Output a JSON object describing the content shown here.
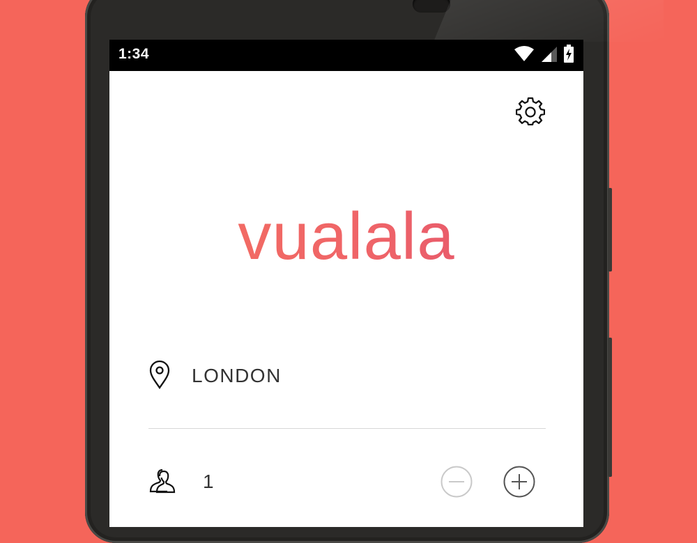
{
  "status_bar": {
    "time": "1:34"
  },
  "logo": {
    "text": "vualala"
  },
  "search": {
    "location_value": "LONDON",
    "guest_count": "1"
  },
  "colors": {
    "background": "#f5655a",
    "logo_start": "#f4705f",
    "logo_end": "#e0506e"
  },
  "icons": [
    "wifi-icon",
    "signal-icon",
    "battery-charging-icon",
    "gear-icon",
    "location-pin-icon",
    "people-icon",
    "minus-circle-icon",
    "plus-circle-icon"
  ]
}
